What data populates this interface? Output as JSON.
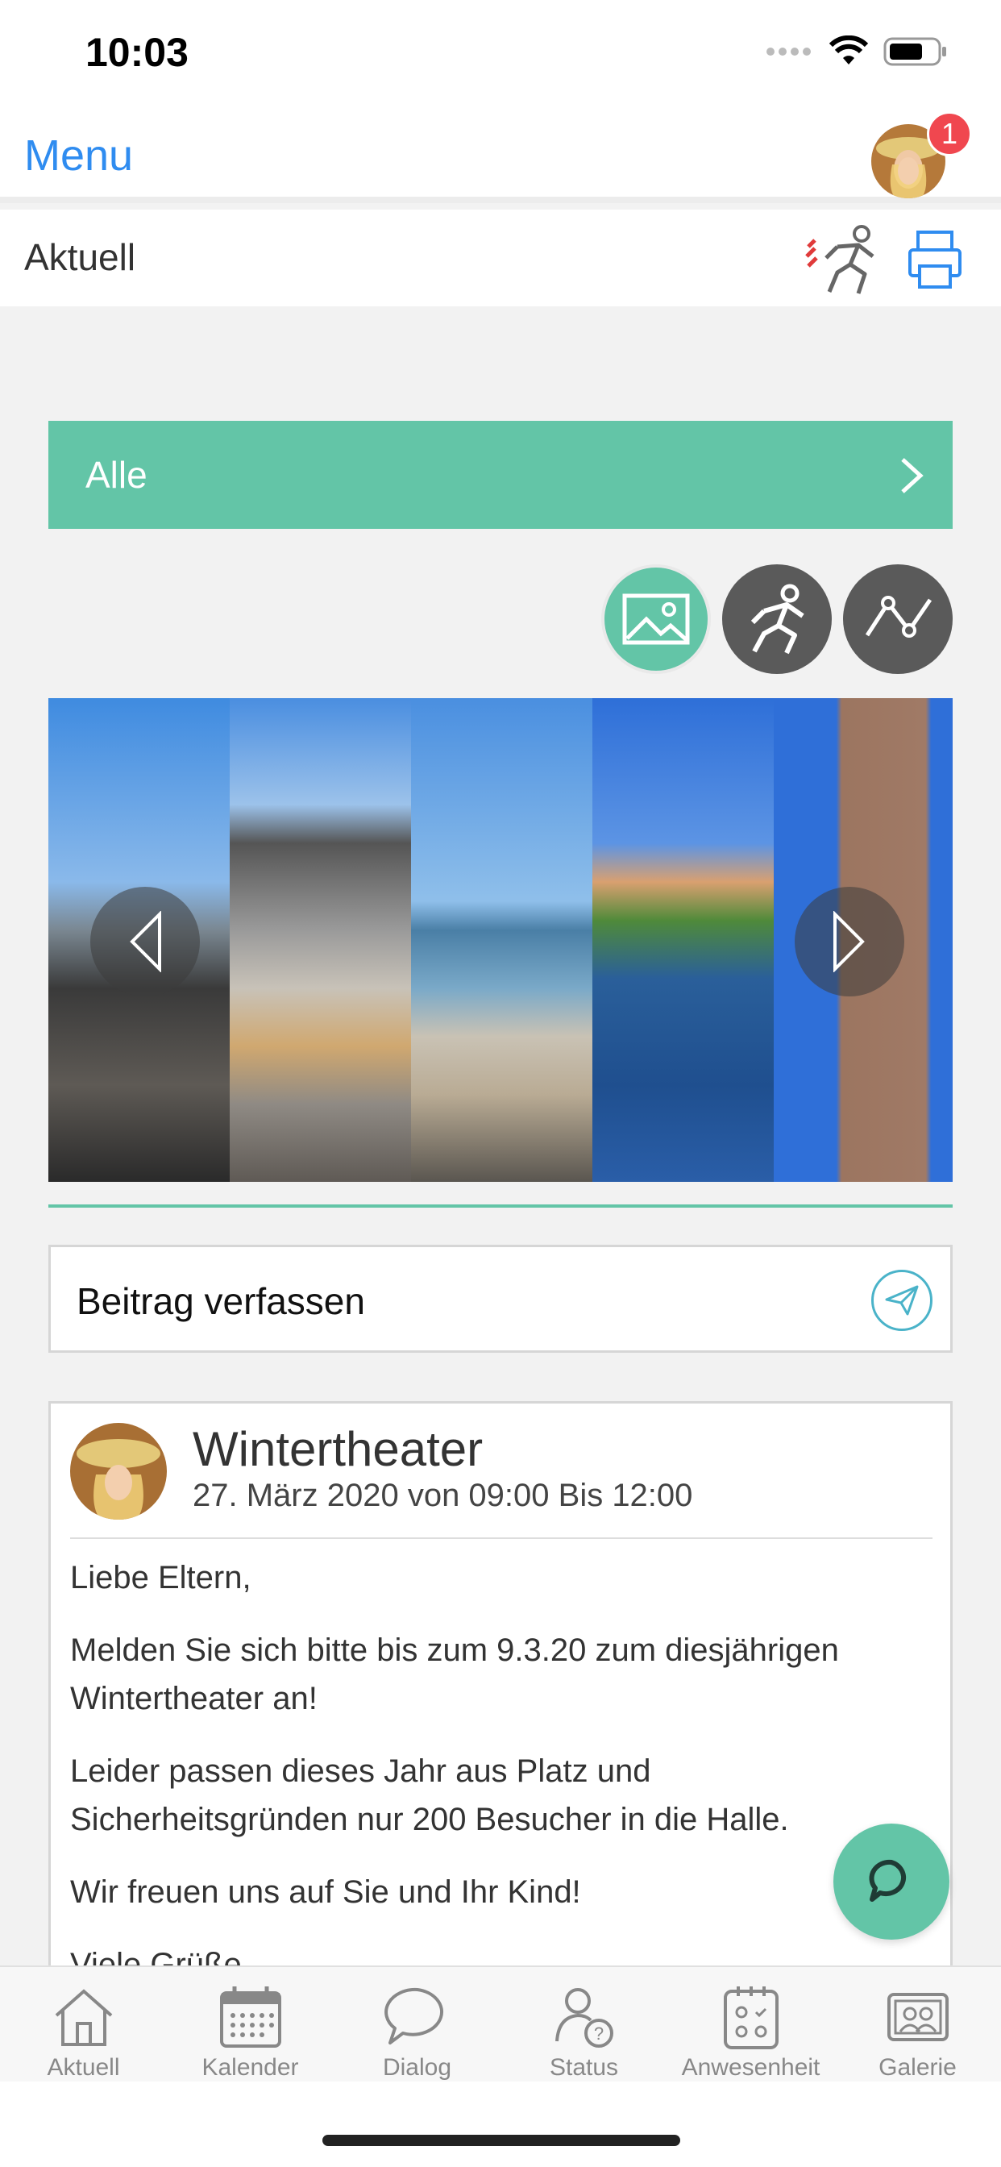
{
  "status_bar": {
    "time": "10:03"
  },
  "nav": {
    "menu_label": "Menu",
    "notification_count": "1"
  },
  "sub_header": {
    "title": "Aktuell"
  },
  "filter": {
    "label": "Alle"
  },
  "media_types": [
    {
      "icon": "image-icon",
      "active": true,
      "color": "#63c5a7"
    },
    {
      "icon": "running-person-icon",
      "active": false,
      "color": "#5a5a5a"
    },
    {
      "icon": "line-chart-icon",
      "active": false,
      "color": "#5a5a5a"
    }
  ],
  "gallery": {
    "photos": [
      "beach-rocks",
      "stacked-stones",
      "sea-pier",
      "river-houses",
      "stone-tower"
    ]
  },
  "compose": {
    "placeholder": "Beitrag verfassen"
  },
  "post": {
    "title": "Wintertheater",
    "date": "27. März 2020 von 09:00 Bis 12:00",
    "paragraphs": [
      "Liebe Eltern,",
      "Melden Sie sich bitte bis zum 9.3.20 zum diesjährigen Wintertheater an!",
      "Leider passen dieses Jahr aus Platz und Sicherheitsgründen nur 200 Besucher in die Halle.",
      "Wir freuen uns auf Sie und Ihr Kind!",
      "Viele Grüße"
    ]
  },
  "tabs": [
    {
      "label": "Aktuell",
      "icon": "house-icon"
    },
    {
      "label": "Kalender",
      "icon": "calendar-icon"
    },
    {
      "label": "Dialog",
      "icon": "speech-bubble-icon"
    },
    {
      "label": "Status",
      "icon": "person-question-icon"
    },
    {
      "label": "Anwesenheit",
      "icon": "attendance-clipboard-icon"
    },
    {
      "label": "Galerie",
      "icon": "photo-album-icon"
    }
  ],
  "colors": {
    "accent": "#63c5a7",
    "link": "#2f8cf0",
    "badge": "#f0474f"
  }
}
